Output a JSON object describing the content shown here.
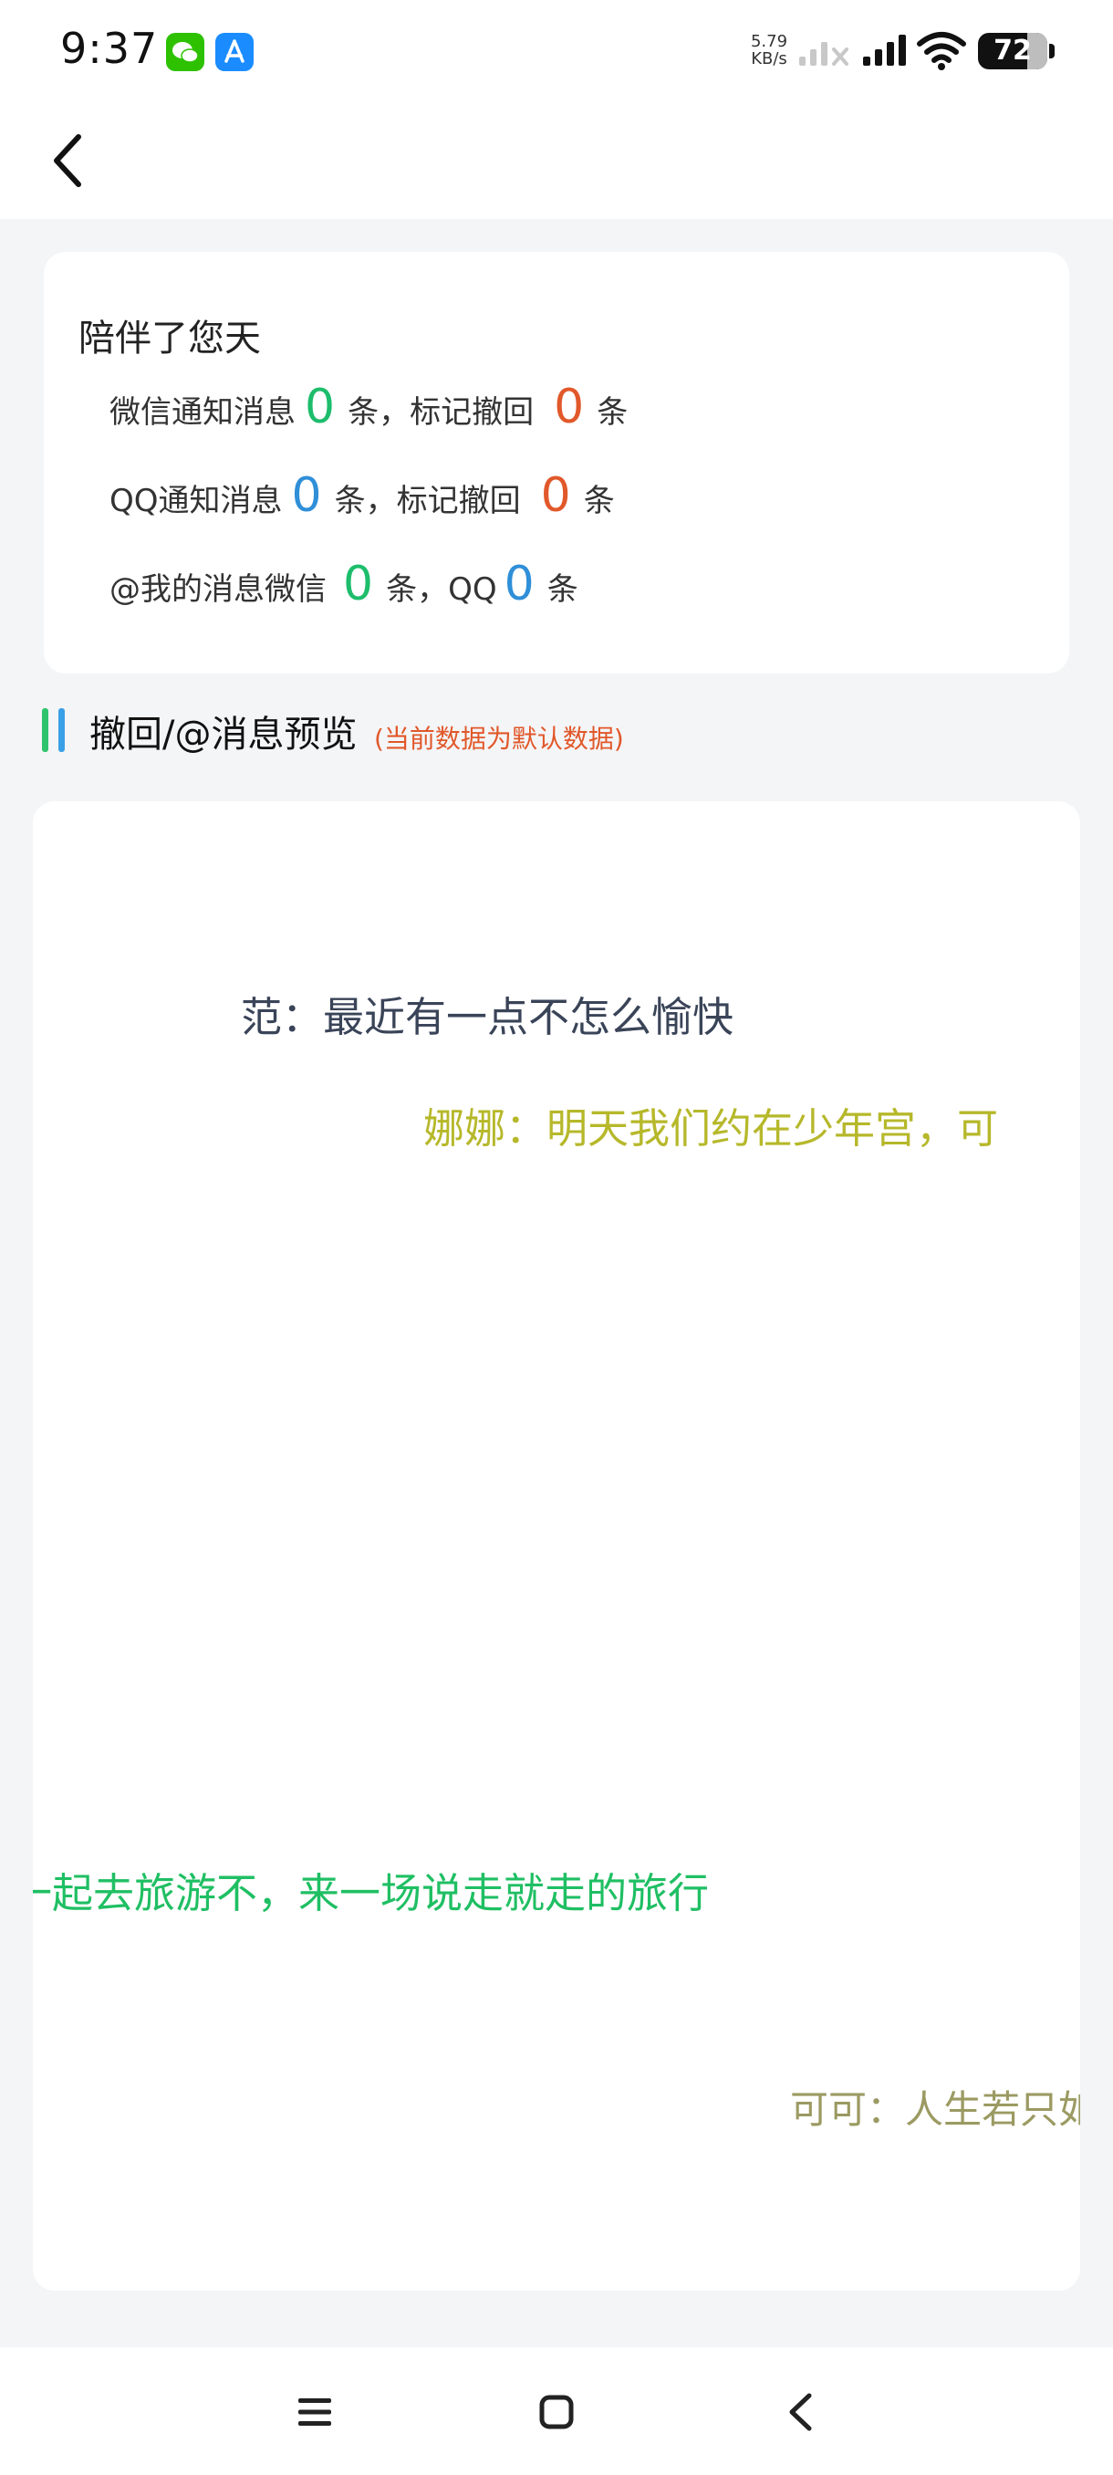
{
  "status_bar": {
    "time": "9:37",
    "net_speed_value": "5.79",
    "net_speed_unit": "KB/s",
    "battery": "72",
    "icons": [
      "wechat-icon",
      "appstore-icon",
      "signal-icon",
      "wifi-icon",
      "battery-icon"
    ]
  },
  "header": {
    "back_icon": "chevron-left-icon"
  },
  "stats": {
    "title": "陪伴了您天",
    "wechat": {
      "label": "微信通知消息",
      "count": "0",
      "unit": "条，标记撤回",
      "recalled": "0",
      "unit_end": "条"
    },
    "qq": {
      "label": "QQ通知消息",
      "count": "0",
      "unit": "条，标记撤回",
      "recalled": "0",
      "unit_end": "条"
    },
    "mentions": {
      "label": "@我的消息微信",
      "wechat_count": "0",
      "mid": "条，QQ",
      "qq_count": "0",
      "unit_end": "条"
    }
  },
  "section": {
    "title": "撤回/@消息预览",
    "note": "(当前数据为默认数据)"
  },
  "preview": {
    "messages": [
      {
        "text": "范：最近有一点不怎么愉快",
        "color": "#3a4458"
      },
      {
        "text": "娜娜：明天我们约在少年宫，可",
        "color": "#b6b82a"
      },
      {
        "text": "一起去旅游不，来一场说走就走的旅行",
        "color": "#1fbf63"
      },
      {
        "text": "可可：人生若只如",
        "color": "#9b9a62"
      }
    ]
  },
  "colors": {
    "green": "#1dbd6b",
    "orange": "#e1582a",
    "blue": "#2f8fd8",
    "background": "#f4f5f7"
  },
  "nav": {
    "icons": [
      "menu-icon",
      "home-icon",
      "back-icon"
    ]
  }
}
